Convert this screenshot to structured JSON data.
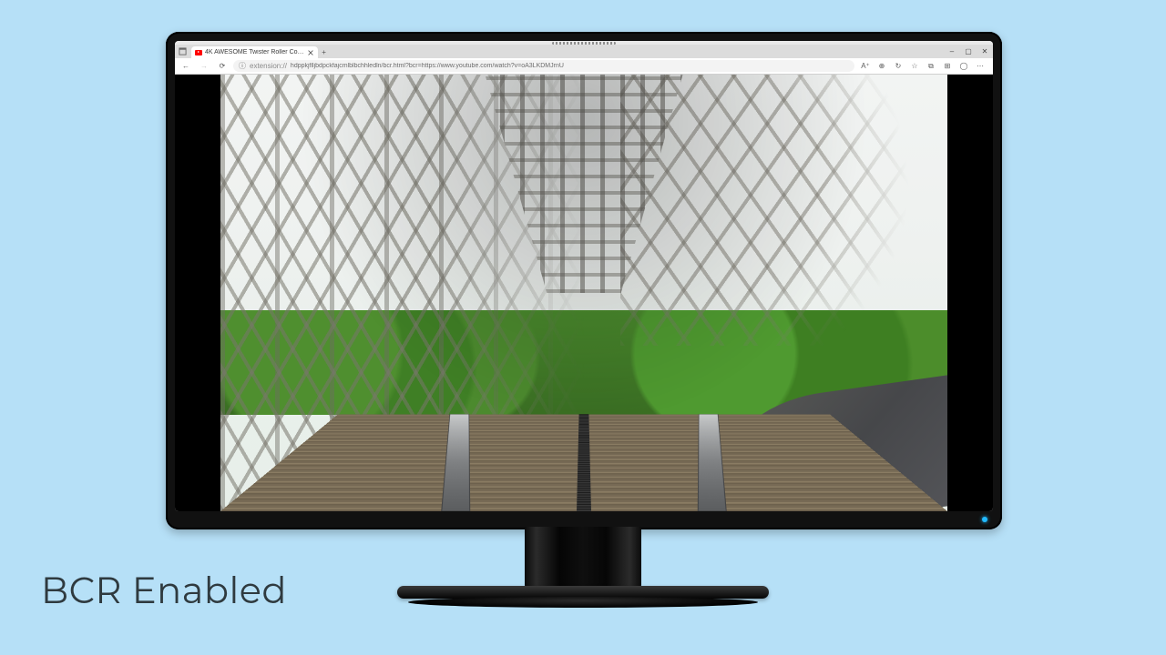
{
  "caption": "BCR Enabled",
  "browser": {
    "tab": {
      "title": "4K AWESOME Twister Roller Co…"
    },
    "address": {
      "protocol_label": "extension://",
      "url": "hdppkjflljbdpckfajcmlblbchhledln/bcr.html?bcr=https://www.youtube.com/watch?v=oA3LKDMJrnU"
    },
    "window_controls": {
      "minimize": "–",
      "maximize": "▢",
      "close": "✕"
    },
    "toolbar": {
      "back": "←",
      "forward": "→",
      "refresh": "⟳",
      "site_info": "ⓘ",
      "new_tab": "+",
      "read_aloud": "A⁺",
      "translate": "⊕",
      "sync": "↻",
      "favorite": "☆",
      "collections": "⧉",
      "extensions": "⊞",
      "profile": "◯",
      "menu": "⋯"
    }
  }
}
